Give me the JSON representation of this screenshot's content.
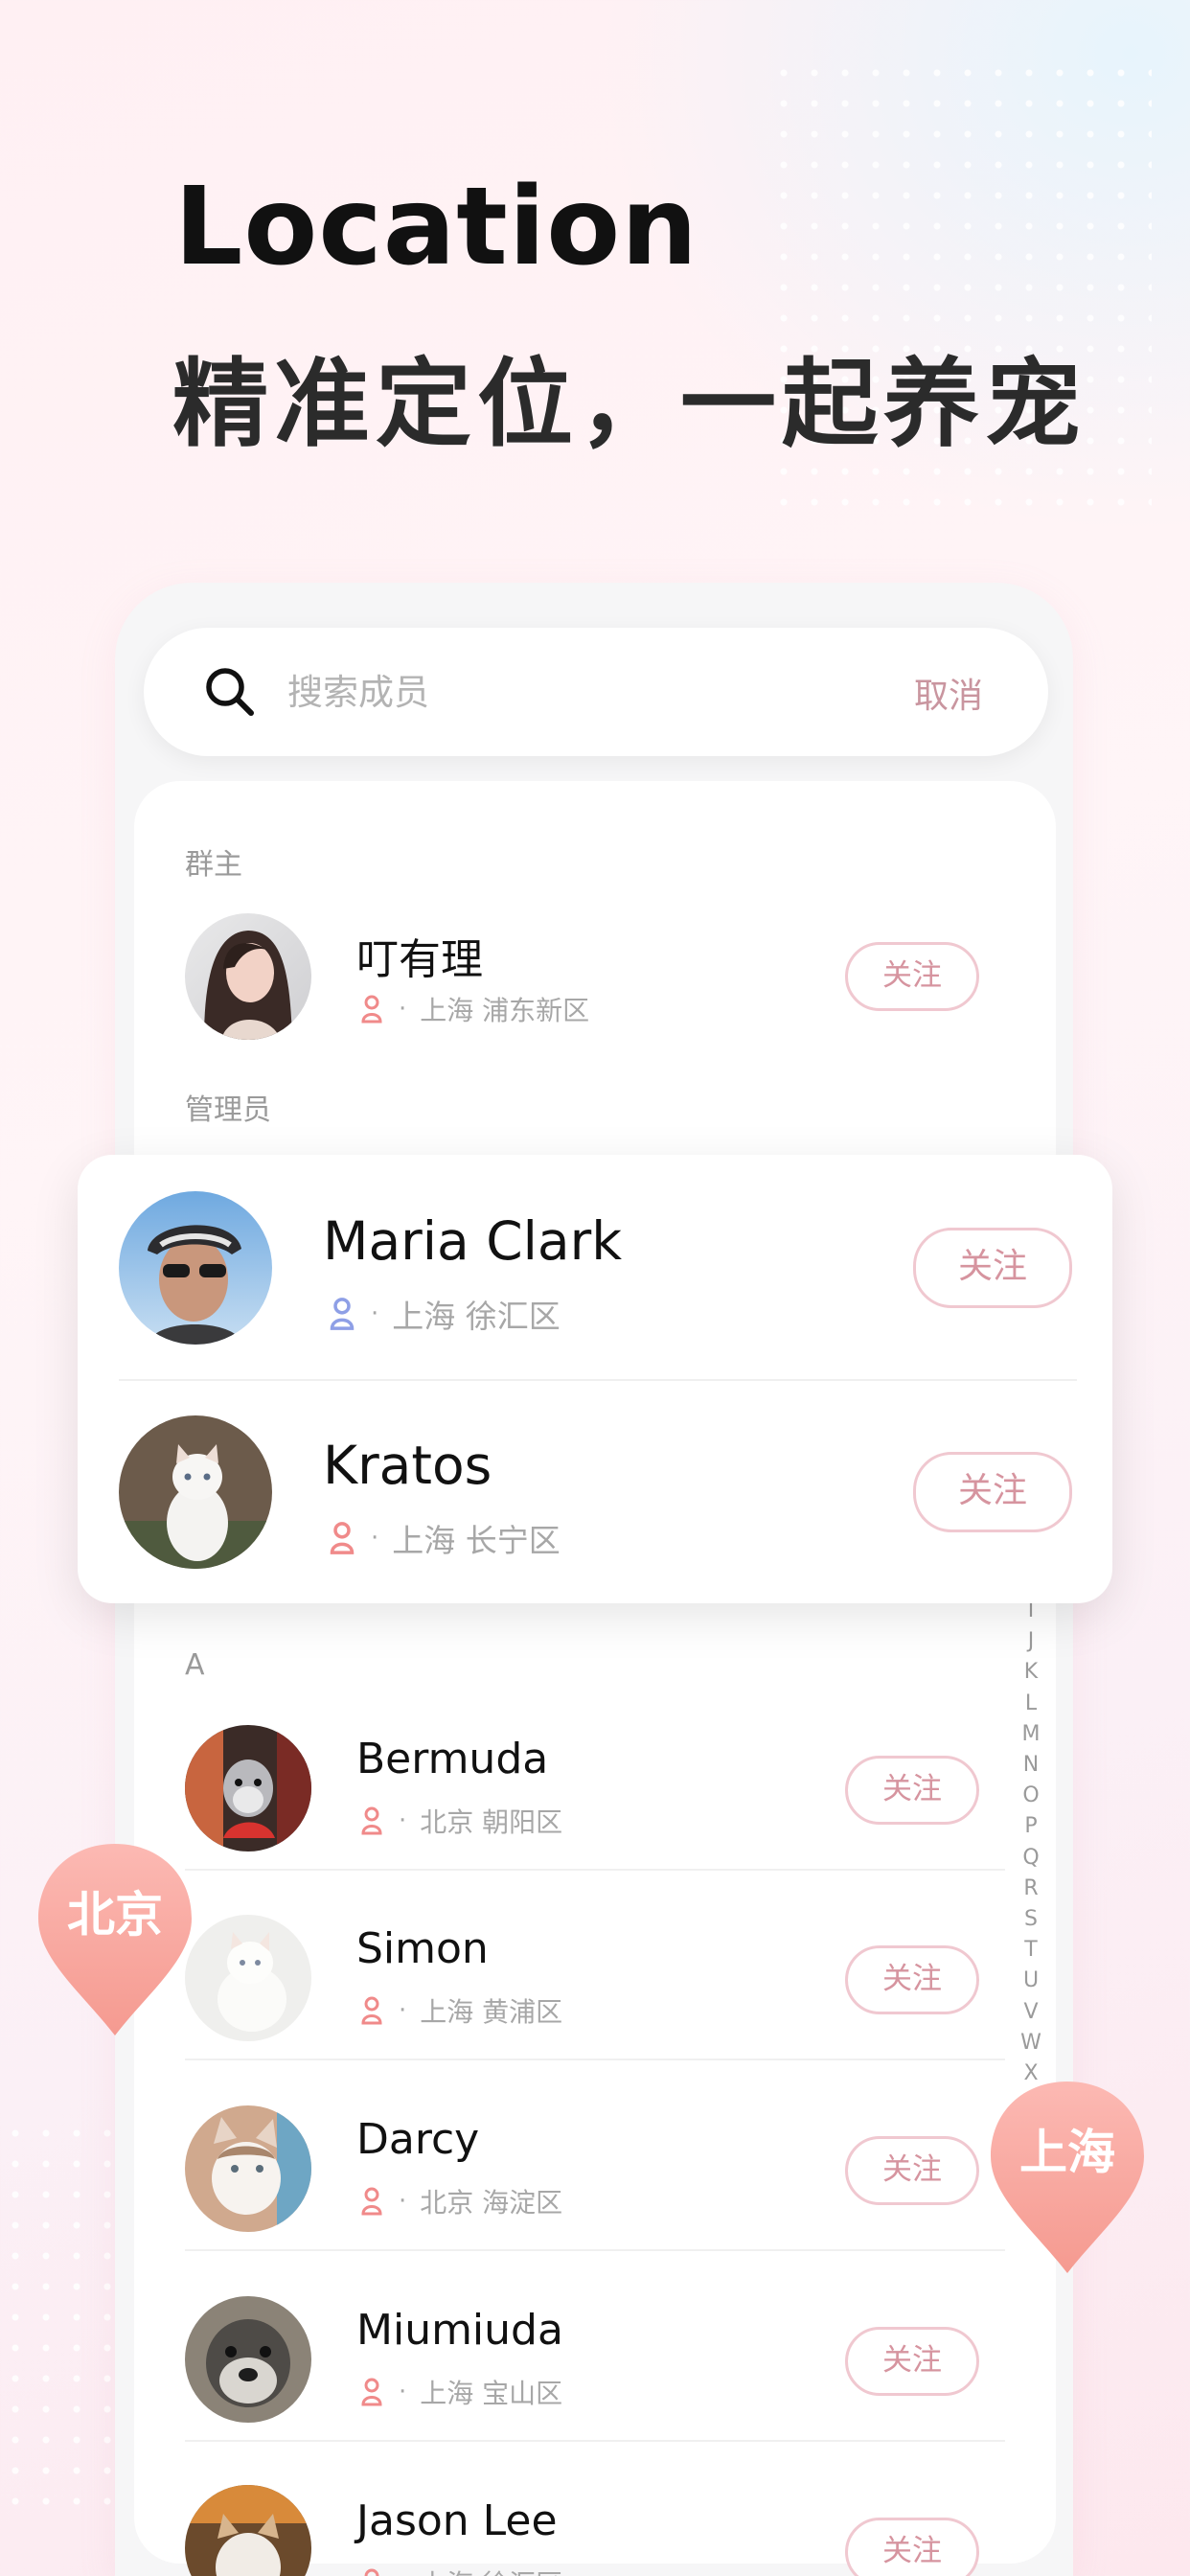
{
  "hero": {
    "title": "Location",
    "subtitle": "精准定位，一起养宠"
  },
  "search": {
    "placeholder": "搜索成员",
    "cancel_label": "取消",
    "icon": "search-icon"
  },
  "sections": {
    "owner_label": "群主",
    "admin_label": "管理员",
    "a_label": "A"
  },
  "follow_label": "关注",
  "owner": {
    "name": "叮有理",
    "gender_icon": "female-person-icon",
    "location": "上海 浦东新区"
  },
  "admins": [
    {
      "name": "Maria Clark",
      "gender_icon": "male-person-icon",
      "location": "上海 徐汇区"
    },
    {
      "name": "Kratos",
      "gender_icon": "female-person-icon",
      "location": "上海 长宁区"
    }
  ],
  "members": [
    {
      "name": "Bermuda",
      "gender_icon": "female-person-icon",
      "location": "北京 朝阳区"
    },
    {
      "name": "Simon",
      "gender_icon": "female-person-icon",
      "location": "上海 黄浦区"
    },
    {
      "name": "Darcy",
      "gender_icon": "female-person-icon",
      "location": "北京 海淀区"
    },
    {
      "name": "Miumiuda",
      "gender_icon": "female-person-icon",
      "location": "上海 宝山区"
    },
    {
      "name": "Jason Lee",
      "gender_icon": "female-person-icon",
      "location": "上海 徐汇区"
    }
  ],
  "index_letters": [
    "I",
    "J",
    "K",
    "L",
    "M",
    "N",
    "O",
    "P",
    "Q",
    "R",
    "S",
    "T",
    "U",
    "V",
    "W",
    "X"
  ],
  "pins": [
    {
      "label": "北京"
    },
    {
      "label": "上海"
    }
  ],
  "colors": {
    "accent_pink": "#d6949f",
    "follow_border": "#f0c8d0",
    "female_icon": "#f08a8a",
    "male_icon": "#8e9fe6",
    "pin_gradient_top": "#fbb5b0",
    "pin_gradient_bottom": "#f5998f"
  }
}
